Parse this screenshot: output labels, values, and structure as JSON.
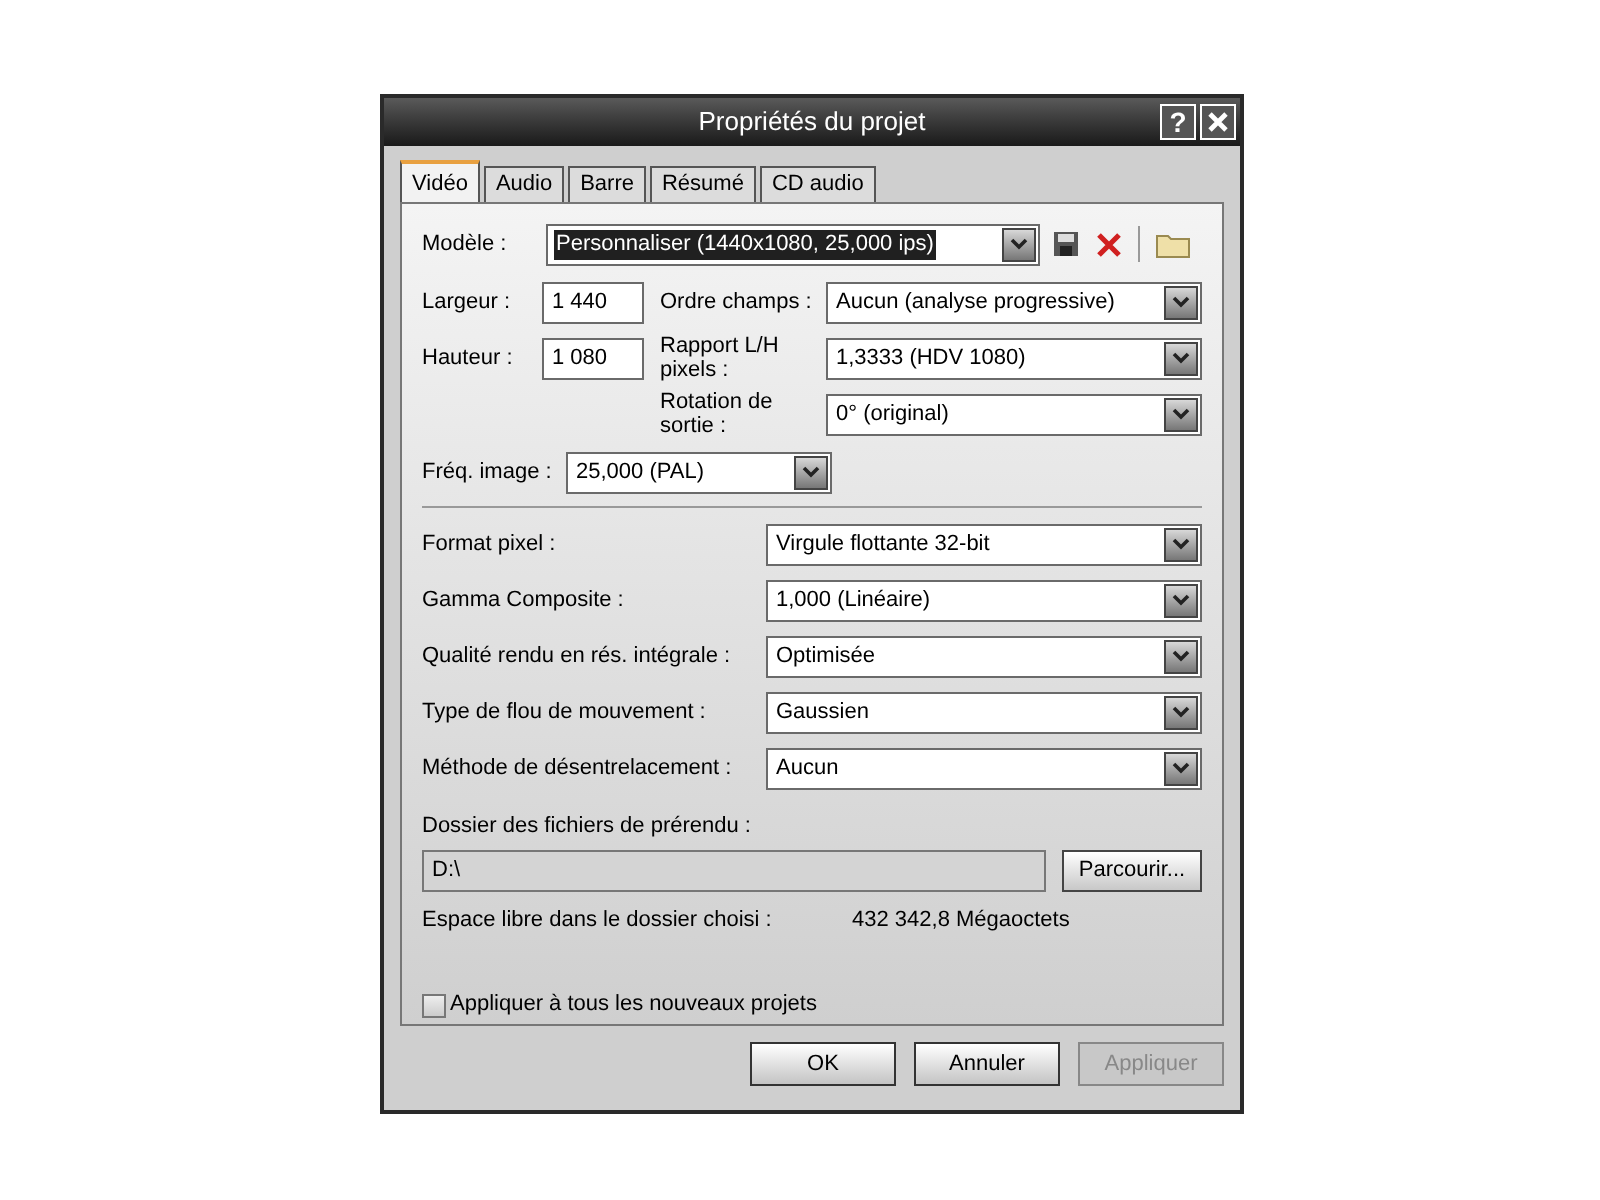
{
  "window": {
    "title": "Propriétés du projet",
    "help_label": "?"
  },
  "tabs": [
    {
      "label": "Vidéo",
      "selected": true
    },
    {
      "label": "Audio",
      "selected": false
    },
    {
      "label": "Barre",
      "selected": false
    },
    {
      "label": "Résumé",
      "selected": false
    },
    {
      "label": "CD audio",
      "selected": false
    }
  ],
  "template": {
    "label": "Modèle :",
    "value": "Personnaliser (1440x1080, 25,000 ips)",
    "highlighted": true
  },
  "width": {
    "label": "Largeur :",
    "value": "1 440"
  },
  "height": {
    "label": "Hauteur :",
    "value": "1 080"
  },
  "field_order": {
    "label": "Ordre champs :",
    "value": "Aucun (analyse progressive)"
  },
  "pixel_aspect": {
    "label": "Rapport L/H pixels :",
    "value": "1,3333 (HDV 1080)"
  },
  "rotation": {
    "label": "Rotation de sortie :",
    "value": "0° (original)"
  },
  "frame_rate": {
    "label": "Fréq. image :",
    "value": "25,000 (PAL)"
  },
  "settings": [
    {
      "label": "Format pixel :",
      "value": "Virgule flottante 32-bit"
    },
    {
      "label": "Gamma Composite :",
      "value": "1,000 (Linéaire)"
    },
    {
      "label": "Qualité rendu en rés. intégrale :",
      "value": "Optimisée"
    },
    {
      "label": "Type de flou de mouvement :",
      "value": "Gaussien"
    },
    {
      "label": "Méthode de désentrelacement :",
      "value": "Aucun"
    }
  ],
  "prerender": {
    "label": "Dossier des fichiers de prérendu :",
    "path": "D:\\",
    "browse_button": "Parcourir..."
  },
  "free_space": {
    "label": "Espace libre dans le dossier choisi :",
    "value": "432 342,8 Mégaoctets"
  },
  "apply_all": {
    "label": "Appliquer à tous les nouveaux projets",
    "checked": false
  },
  "buttons": [
    {
      "label": "OK",
      "disabled": false
    },
    {
      "label": "Annuler",
      "disabled": false
    },
    {
      "label": "Appliquer",
      "disabled": true
    }
  ]
}
